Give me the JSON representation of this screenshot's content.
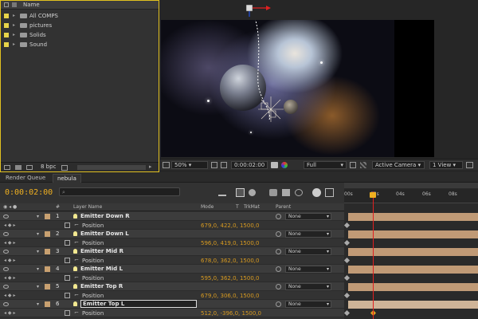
{
  "project": {
    "column_name": "Name",
    "items": [
      {
        "label": "All COMPS",
        "icon": "folder-icon"
      },
      {
        "label": "pictures",
        "icon": "folder-icon"
      },
      {
        "label": "Solids",
        "icon": "folder-icon"
      },
      {
        "label": "Sound",
        "icon": "folder-icon"
      }
    ],
    "bit_depth": "8 bpc"
  },
  "viewer": {
    "zoom": "50%",
    "timecode": "0:00:02:00",
    "resolution": "Full",
    "camera": "Active Camera",
    "views": "1 View"
  },
  "tabs": [
    {
      "label": "Render Queue"
    },
    {
      "label": "nebula"
    }
  ],
  "timeline": {
    "current_time": "0:00:02:00",
    "columns": {
      "num": "#",
      "layer_name": "Layer Name",
      "mode": "Mode",
      "t": "T",
      "trkmat": "TrkMat",
      "parent": "Parent"
    },
    "ruler_labels": [
      "00s",
      "02s",
      "04s",
      "06s",
      "08s"
    ],
    "layers": [
      {
        "num": "1",
        "name": "Emitter Down R",
        "parent": "None",
        "prop": "Position",
        "value": "679,0, 422,0, 1500,0"
      },
      {
        "num": "2",
        "name": "Emitter Down L",
        "parent": "None",
        "prop": "Position",
        "value": "596,0, 419,0, 1500,0"
      },
      {
        "num": "3",
        "name": "Emitter Mid R",
        "parent": "None",
        "prop": "Position",
        "value": "678,0, 362,0, 1500,0"
      },
      {
        "num": "4",
        "name": "Emitter Mid L",
        "parent": "None",
        "prop": "Position",
        "value": "595,0, 362,0, 1500,0"
      },
      {
        "num": "5",
        "name": "Emitter Top R",
        "parent": "None",
        "prop": "Position",
        "value": "679,0, 306,0, 1500,0"
      },
      {
        "num": "6",
        "name": "Emitter Top L",
        "parent": "None",
        "prop": "Position",
        "value": "512,0, -396,0, 1500,0"
      }
    ]
  },
  "colors": {
    "accent_timecode": "#f0b020",
    "playhead": "#e02020",
    "layer_bar": "#c09a76",
    "label_swatch": "#e8d44a"
  }
}
